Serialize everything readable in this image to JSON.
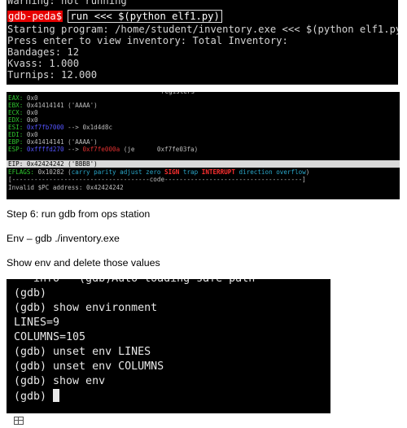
{
  "terminal1": {
    "warning": "Warning: not running",
    "prompt": "gdb-peda$",
    "command": "run <<< $(python elf1.py)",
    "lines": [
      "Starting program: /home/student/inventory.exe <<< $(python elf1.py)",
      "Press enter to view inventory: Total Inventory:",
      "Bandages: 12",
      "Kvass: 1.000",
      "Turnips: 12.000"
    ]
  },
  "terminal2": {
    "header": "registers",
    "regs": [
      {
        "name": "EAX:",
        "value": " 0x0",
        "extra": ""
      },
      {
        "name": "EBX:",
        "value": " 0x41414141 ('AAAA')",
        "extra": ""
      },
      {
        "name": "ECX:",
        "value": " 0x0",
        "extra": ""
      },
      {
        "name": "EDX:",
        "value": " 0x0",
        "extra": ""
      },
      {
        "name": "ESI:",
        "value": " ",
        "addr": "0xf7fb7000",
        "extra": " --> 0x1d4d8c"
      },
      {
        "name": "EDI:",
        "value": " 0x0",
        "extra": ""
      },
      {
        "name": "EBP:",
        "value": " 0x41414141 ('AAAA')",
        "extra": ""
      }
    ],
    "esp": {
      "name": "ESP:",
      "addr": "0xffffd270",
      "arrow": " --> ",
      "target": "0xf7fe000a",
      "tail": " (je      0xf7fe03fa)"
    },
    "eip": "EIP: 0x42424242 ('BBBB')",
    "eflags_name": "EFLAGS:",
    "eflags_value": " 0x10282 (",
    "eflags_flags_a": "carry parity adjust zero ",
    "eflags_sign": "SIGN",
    "eflags_flags_b": " trap ",
    "eflags_intr": "INTERRUPT",
    "eflags_flags_c": " direction overflow",
    "eflags_close": ")",
    "code_line": "[-------------------------------------code-------------------------------------]",
    "invalid": "Invalid $PC address: 0x42424242"
  },
  "captions": {
    "step6": "Step 6: run gdb from ops station",
    "env": "Env – gdb ./inventory.exe",
    "show": "Show env and delete those values"
  },
  "terminal3": {
    "top_line": "   info  \"(gdb)Auto-loading safe path\"",
    "lines": [
      "(gdb)",
      "(gdb) show environment",
      "LINES=9",
      "COLUMNS=105",
      "(gdb) unset env LINES",
      "(gdb) unset env COLUMNS",
      "(gdb) show env"
    ],
    "last_prompt": "(gdb) "
  }
}
